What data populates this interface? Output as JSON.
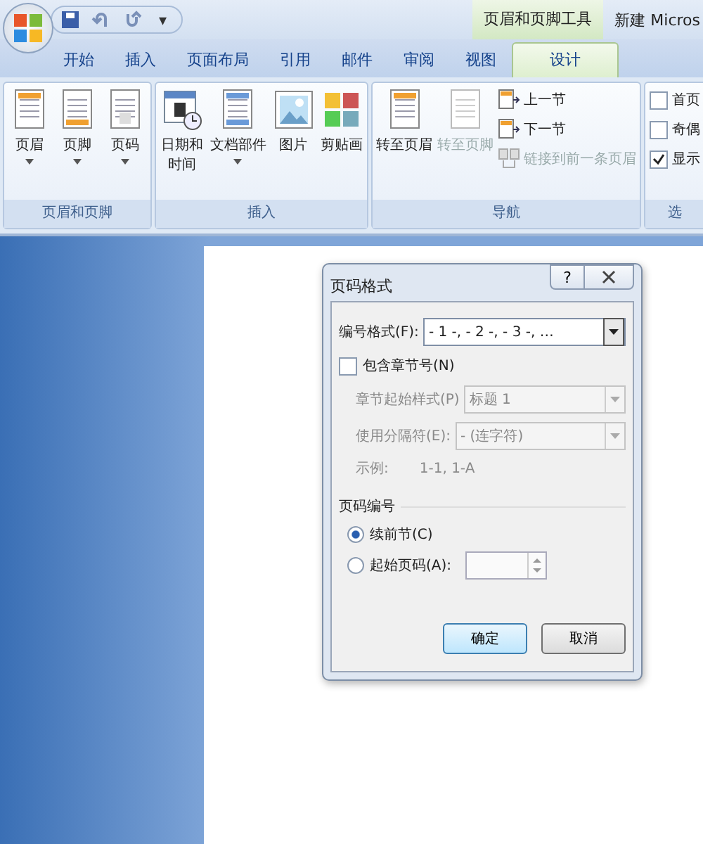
{
  "window": {
    "title": "新建 Micros",
    "context_tab_group": "页眉和页脚工具",
    "quick_access_menu": "▾"
  },
  "tabs": [
    {
      "label": "开始",
      "selected": false
    },
    {
      "label": "插入",
      "selected": false
    },
    {
      "label": "页面布局",
      "selected": false
    },
    {
      "label": "引用",
      "selected": false
    },
    {
      "label": "邮件",
      "selected": false
    },
    {
      "label": "审阅",
      "selected": false
    },
    {
      "label": "视图",
      "selected": false
    },
    {
      "label": "设计",
      "selected": true
    }
  ],
  "ribbon_groups": [
    {
      "label": "页眉和页脚",
      "items": [
        {
          "kind": "large",
          "label": "页眉",
          "dropdown": true,
          "disabled": false
        },
        {
          "kind": "large",
          "label": "页脚",
          "dropdown": true,
          "disabled": false
        },
        {
          "kind": "large",
          "label": "页码",
          "dropdown": true,
          "disabled": false
        }
      ]
    },
    {
      "label": "插入",
      "items": [
        {
          "kind": "large",
          "label": "日期和时间",
          "wrap": true,
          "dropdown": false,
          "disabled": false
        },
        {
          "kind": "large",
          "label": "文档部件",
          "dropdown": true,
          "disabled": false
        },
        {
          "kind": "large",
          "label": "图片",
          "dropdown": false,
          "disabled": false
        },
        {
          "kind": "large",
          "label": "剪贴画",
          "dropdown": false,
          "disabled": false
        }
      ]
    },
    {
      "label": "导航",
      "items": [
        {
          "kind": "large",
          "label": "转至页眉",
          "dropdown": false,
          "disabled": false
        },
        {
          "kind": "large",
          "label": "转至页脚",
          "dropdown": false,
          "disabled": true
        },
        {
          "kind": "stack",
          "entries": [
            {
              "label": "上一节",
              "disabled": false
            },
            {
              "label": "下一节",
              "disabled": false
            },
            {
              "label": "链接到前一条页眉",
              "disabled": true
            }
          ]
        }
      ]
    },
    {
      "label": "选",
      "items": [
        {
          "kind": "checks",
          "entries": [
            {
              "label": "首页",
              "checked": false
            },
            {
              "label": "奇偶",
              "checked": false
            },
            {
              "label": "显示",
              "checked": true
            }
          ]
        }
      ]
    }
  ],
  "dialog": {
    "title": "页码格式",
    "help": "?",
    "format": {
      "label": "编号格式(F):",
      "value": "- 1 -, - 2 -, - 3 -, …"
    },
    "include_chapter": {
      "label": "包含章节号(N)",
      "checked": false
    },
    "chapter_style": {
      "label": "章节起始样式(P)",
      "value": "标题 1",
      "disabled": true
    },
    "separator": {
      "label": "使用分隔符(E):",
      "value": "-  (连字符)",
      "disabled": true
    },
    "example": {
      "label": "示例:",
      "value": "1-1, 1-A"
    },
    "numbering_section": "页码编号",
    "radios": [
      {
        "kind": "plain",
        "label": "续前节(C)",
        "selected": true
      },
      {
        "kind": "spinner",
        "label": "起始页码(A):",
        "selected": false
      }
    ],
    "buttons": [
      {
        "label": "确定",
        "default": true
      },
      {
        "label": "取消",
        "default": false
      }
    ]
  }
}
